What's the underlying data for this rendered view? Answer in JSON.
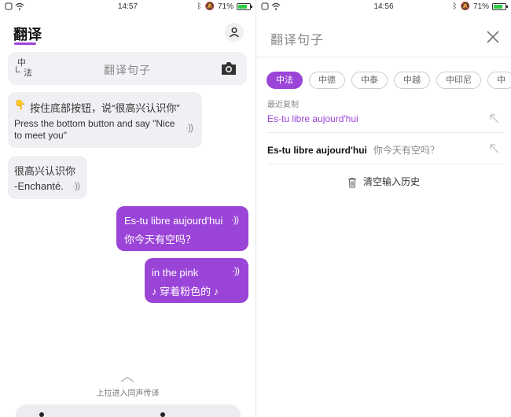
{
  "left": {
    "status": {
      "time": "14:57",
      "battery": "71%"
    },
    "app_title": "翻译",
    "search": {
      "lang_top": "中",
      "lang_bottom": "法",
      "placeholder": "翻译句子"
    },
    "messages": [
      {
        "side": "left",
        "hand": "👇",
        "line1": "按住底部按钮，说“很高兴认识你”",
        "line2": "Press the bottom button and say \"Nice",
        "line3": "to meet you\""
      },
      {
        "side": "left",
        "line1": "很高兴认识你",
        "line2": "-Enchanté."
      },
      {
        "side": "right",
        "line1": "Es-tu libre aujourd'hui",
        "line2": "你今天有空吗？"
      },
      {
        "side": "right",
        "line1": "in the pink",
        "line2": "♪ 穿着粉色的 ♪"
      }
    ],
    "pull_hint": "上拉进入同声传译"
  },
  "right": {
    "status": {
      "time": "14:56",
      "battery": "71%"
    },
    "search_title": "翻译句子",
    "chips": [
      "中法",
      "中德",
      "中泰",
      "中越",
      "中印尼",
      "中"
    ],
    "active_chip": 0,
    "recent_label": "最近复制",
    "recent_copied": "Es-tu libre aujourd'hui",
    "history": [
      {
        "source": "Es-tu libre aujourd'hui",
        "translation": "你今天有空吗？"
      }
    ],
    "clear_history": "清空输入历史"
  },
  "colors": {
    "accent": "#9b45d8",
    "bubble_gray": "#f0f0f4",
    "battery": "#2ecc40"
  }
}
